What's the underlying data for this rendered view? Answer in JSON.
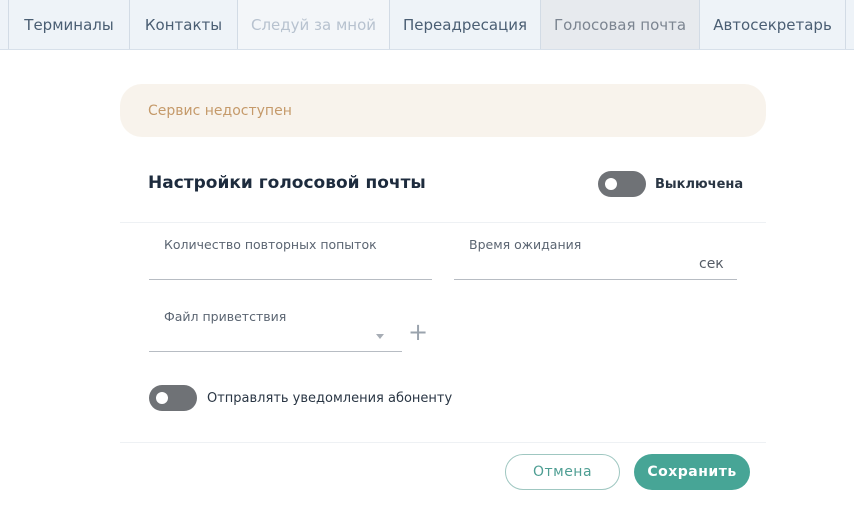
{
  "tabs": [
    {
      "label": "Терминалы",
      "state": "normal"
    },
    {
      "label": "Контакты",
      "state": "normal"
    },
    {
      "label": "Следуй за мной",
      "state": "disabled"
    },
    {
      "label": "Переадресация",
      "state": "normal"
    },
    {
      "label": "Голосовая почта",
      "state": "active"
    },
    {
      "label": "Автосекретарь",
      "state": "normal"
    }
  ],
  "banner": {
    "text": "Сервис недоступен"
  },
  "voicemail": {
    "title": "Настройки голосовой почты",
    "toggle_label": "Выключена",
    "toggle_on": false
  },
  "fields": {
    "retries_label": "Количество повторных попыток",
    "retries_value": "",
    "wait_label": "Время ожидания",
    "wait_value": "",
    "wait_unit": "сек",
    "greeting_label": "Файл приветствия",
    "greeting_value": ""
  },
  "notify": {
    "label": "Отправлять уведомления абоненту",
    "toggle_on": false
  },
  "actions": {
    "cancel": "Отмена",
    "save": "Сохранить"
  },
  "colors": {
    "accent": "#47a596",
    "banner_bg": "#f8f3ec",
    "banner_text": "#c59a6a",
    "toggle_off": "#6f7276"
  }
}
